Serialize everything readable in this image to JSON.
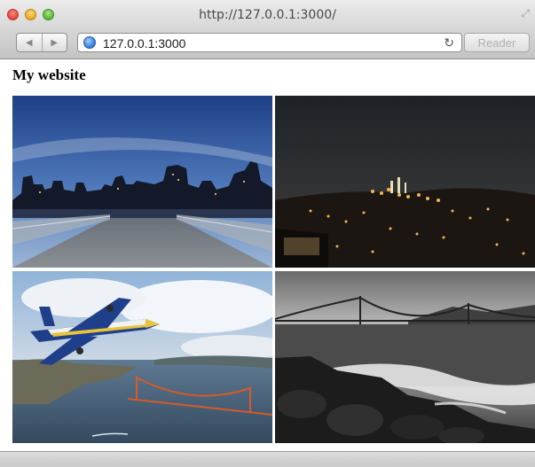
{
  "window": {
    "title": "http://127.0.0.1:3000/"
  },
  "toolbar": {
    "back_glyph": "◀",
    "forward_glyph": "▶",
    "url": "127.0.0.1:3000",
    "reload_glyph": "↻",
    "reader_label": "Reader"
  },
  "page": {
    "heading": "My website",
    "photos": [
      {
        "name": "city-skyline-dusk-photo"
      },
      {
        "name": "city-lights-night-photo"
      },
      {
        "name": "blue-angels-plane-bay-photo"
      },
      {
        "name": "golden-gate-bw-photo"
      }
    ]
  },
  "colors": {
    "accent": "#2f79d6"
  }
}
